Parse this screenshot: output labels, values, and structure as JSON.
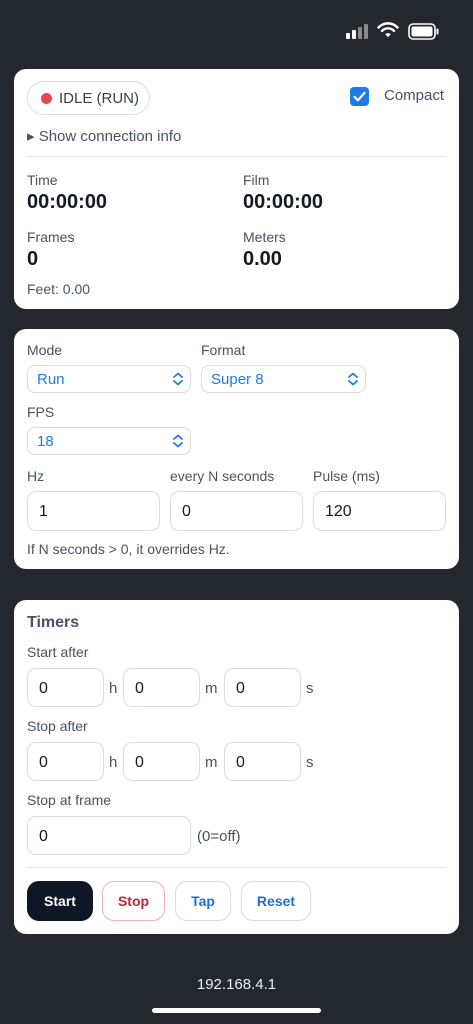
{
  "status": {
    "label": "IDLE (RUN)",
    "dot_color": "#e5484d"
  },
  "compact": {
    "label": "Compact",
    "checked": true
  },
  "connection": {
    "toggle_label": "▸ Show connection info"
  },
  "readouts": {
    "time_label": "Time",
    "time_value": "00:00:00",
    "film_label": "Film",
    "film_value": "00:00:00",
    "frames_label": "Frames",
    "frames_value": "0",
    "meters_label": "Meters",
    "meters_value": "0.00",
    "feet_text": "Feet: 0.00"
  },
  "settings": {
    "mode_label": "Mode",
    "mode_value": "Run",
    "format_label": "Format",
    "format_value": "Super 8",
    "fps_label": "FPS",
    "fps_value": "18",
    "hz_label": "Hz",
    "hz_value": "1",
    "every_label": "every N seconds",
    "every_value": "0",
    "pulse_label": "Pulse (ms)",
    "pulse_value": "120",
    "note": "If N seconds > 0, it overrides Hz."
  },
  "timers": {
    "title": "Timers",
    "start_after_label": "Start after",
    "start_h": "0",
    "start_m": "0",
    "start_s": "0",
    "stop_after_label": "Stop after",
    "stop_h": "0",
    "stop_m": "0",
    "stop_s": "0",
    "unit_h": "h",
    "unit_m": "m",
    "unit_s": "s",
    "stop_frame_label": "Stop at frame",
    "stop_frame_value": "0",
    "stop_frame_hint": "(0=off)"
  },
  "actions": {
    "start": "Start",
    "stop": "Stop",
    "tap": "Tap",
    "reset": "Reset"
  },
  "footer": {
    "ip": "192.168.4.1"
  },
  "colors": {
    "accent": "#1e7ae6",
    "background": "#23272e",
    "start_button": "#0f1726",
    "stop_text": "#c0262d"
  }
}
